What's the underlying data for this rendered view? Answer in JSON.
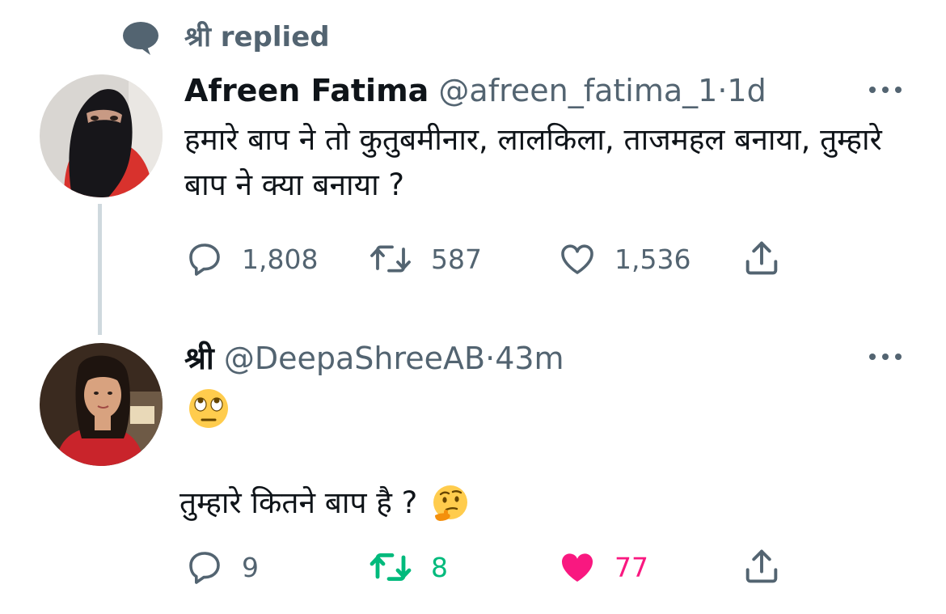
{
  "context": {
    "text": "श्री replied",
    "icon": "speech-bubble-icon"
  },
  "tweets": [
    {
      "name": "Afreen Fatima",
      "handle": "@afreen_fatima_1",
      "sep": "·",
      "time": "1d",
      "text": "हमारे बाप ने तो कुतुबमीनार, लालकिला, ताजमहल बनाया, तुम्हारे बाप ने क्या बनाया ?",
      "actions": {
        "replies": "1,808",
        "retweets": "587",
        "likes": "1,536"
      }
    },
    {
      "name": "श्री",
      "handle": "@DeepaShreeAB",
      "sep": "·",
      "time": "43m",
      "emoji_line": "face-with-rolling-eyes",
      "text": "तुम्हारे कितने बाप है ?",
      "inline_emoji": "thinking-face",
      "actions": {
        "replies": "9",
        "retweets": "8",
        "likes": "77"
      },
      "retweeted": true,
      "liked": true
    }
  ],
  "colors": {
    "secondary_text": "#536471",
    "retweet_active": "#00ba7c",
    "like_active": "#f91880",
    "thread_line": "#cfd9de"
  }
}
